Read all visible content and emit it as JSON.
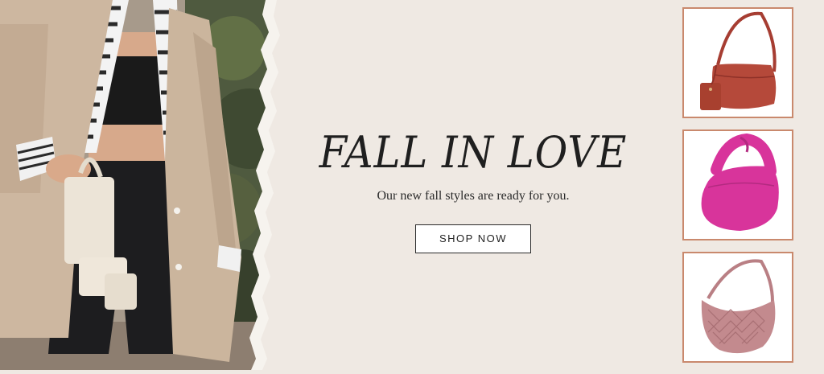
{
  "hero": {
    "headline": "FALL IN LOVE",
    "subhead": "Our new fall styles are ready for you.",
    "cta_label": "SHOP NOW"
  },
  "products": [
    {
      "name": "red-shoulder-bag",
      "color": "#b5493a"
    },
    {
      "name": "pink-hobo-bag",
      "color": "#d8349b"
    },
    {
      "name": "woven-mauve-bag",
      "color": "#c38a8e"
    }
  ],
  "colors": {
    "background": "#efe9e3",
    "tile_border": "#c9896d",
    "blazer": "#cdb7a0"
  }
}
